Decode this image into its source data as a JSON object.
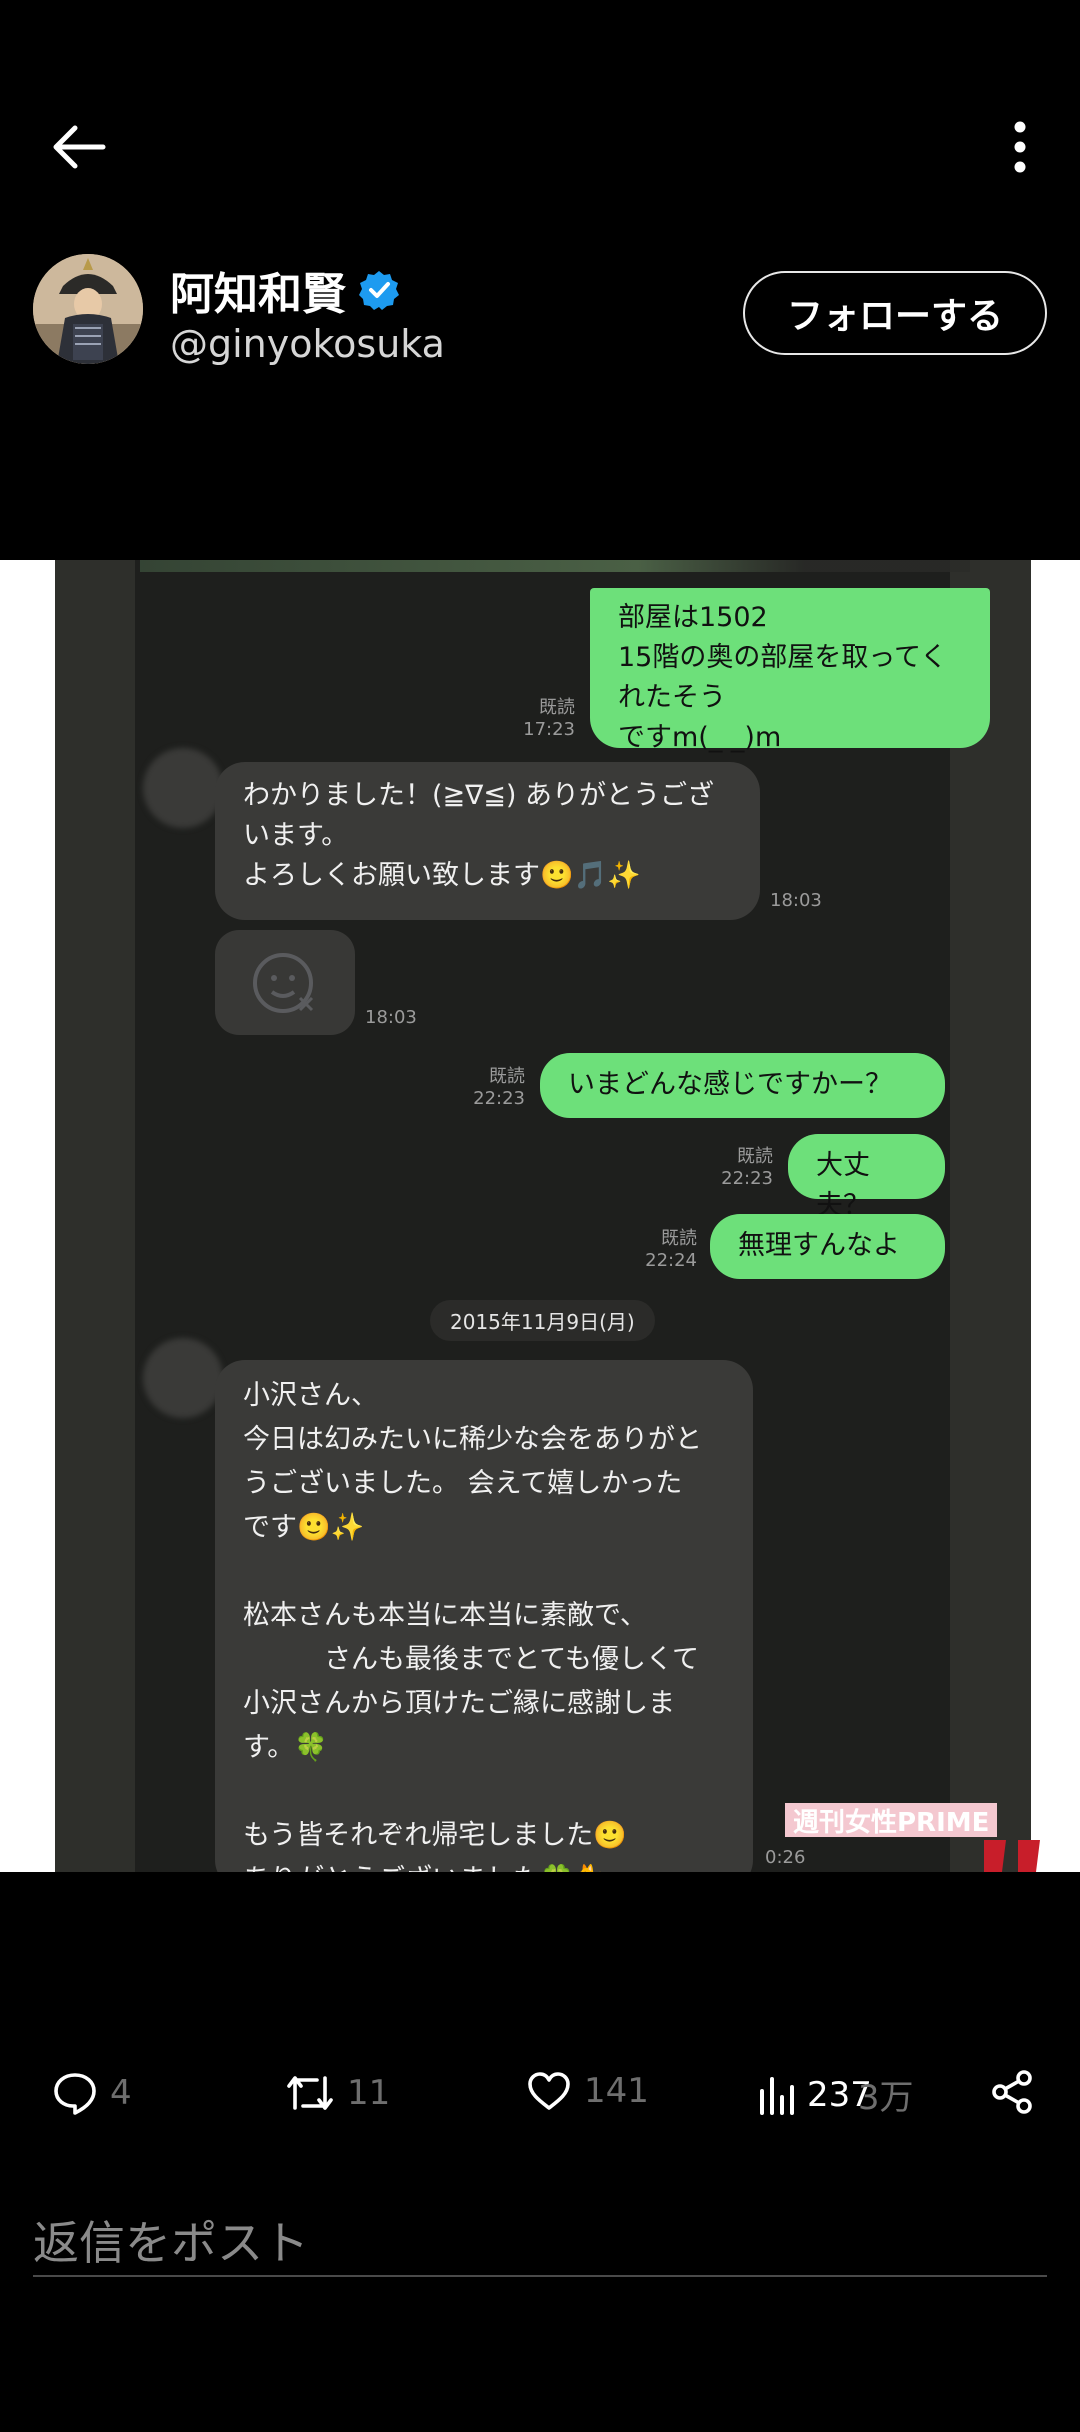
{
  "header": {
    "back_icon": "arrow-left-icon",
    "more_icon": "more-vertical-icon"
  },
  "author": {
    "name": "阿知和賢",
    "handle": "@ginyokosuka",
    "verified": true,
    "verified_color": "#1d9bf0",
    "follow_label": "フォローする"
  },
  "chat": {
    "messages": [
      {
        "side": "mine",
        "text": "部屋は1502\n15階の奥の部屋を取ってくれたそう\nですm(_ _)m",
        "read": "既読",
        "time": "17:23"
      },
      {
        "side": "theirs",
        "text": "わかりました！(≧∇≦) ありがとうござ\nいます。\nよろしくお願い致します🙂🎵✨",
        "time": "18:03"
      },
      {
        "side": "theirs-sticker",
        "time": "18:03"
      },
      {
        "side": "mine",
        "text": "いまどんな感じですかー？",
        "read": "既読",
        "time": "22:23"
      },
      {
        "side": "mine",
        "text": "大丈夫？",
        "read": "既読",
        "time": "22:23"
      },
      {
        "side": "mine",
        "text": "無理すんなよ",
        "read": "既読",
        "time": "22:24"
      },
      {
        "side": "theirs",
        "text": "小沢さん、\n今日は幻みたいに稀少な会をありがと\nうございました。 会えて嬉しかった\nです🙂✨\n\n松本さんも本当に本当に素敵で、\n　　　さんも最後までとても優しくて\n小沢さんから頂けたご縁に感謝しま\nす。🍀\n\nもう皆それぞれ帰宅しました🙂\nありがとうございました🍀🐈",
        "time": "0:26"
      }
    ],
    "date_separator": "2015年11月9日(月)",
    "watermark": "週刊女性PRIME"
  },
  "actions": {
    "replies": "4",
    "reposts": "11",
    "likes": "141",
    "views": "237",
    "views_overlap": "3万",
    "icons": [
      "reply-icon",
      "repost-icon",
      "like-icon",
      "views-icon",
      "share-icon"
    ]
  },
  "reply": {
    "placeholder": "返信をポスト"
  }
}
